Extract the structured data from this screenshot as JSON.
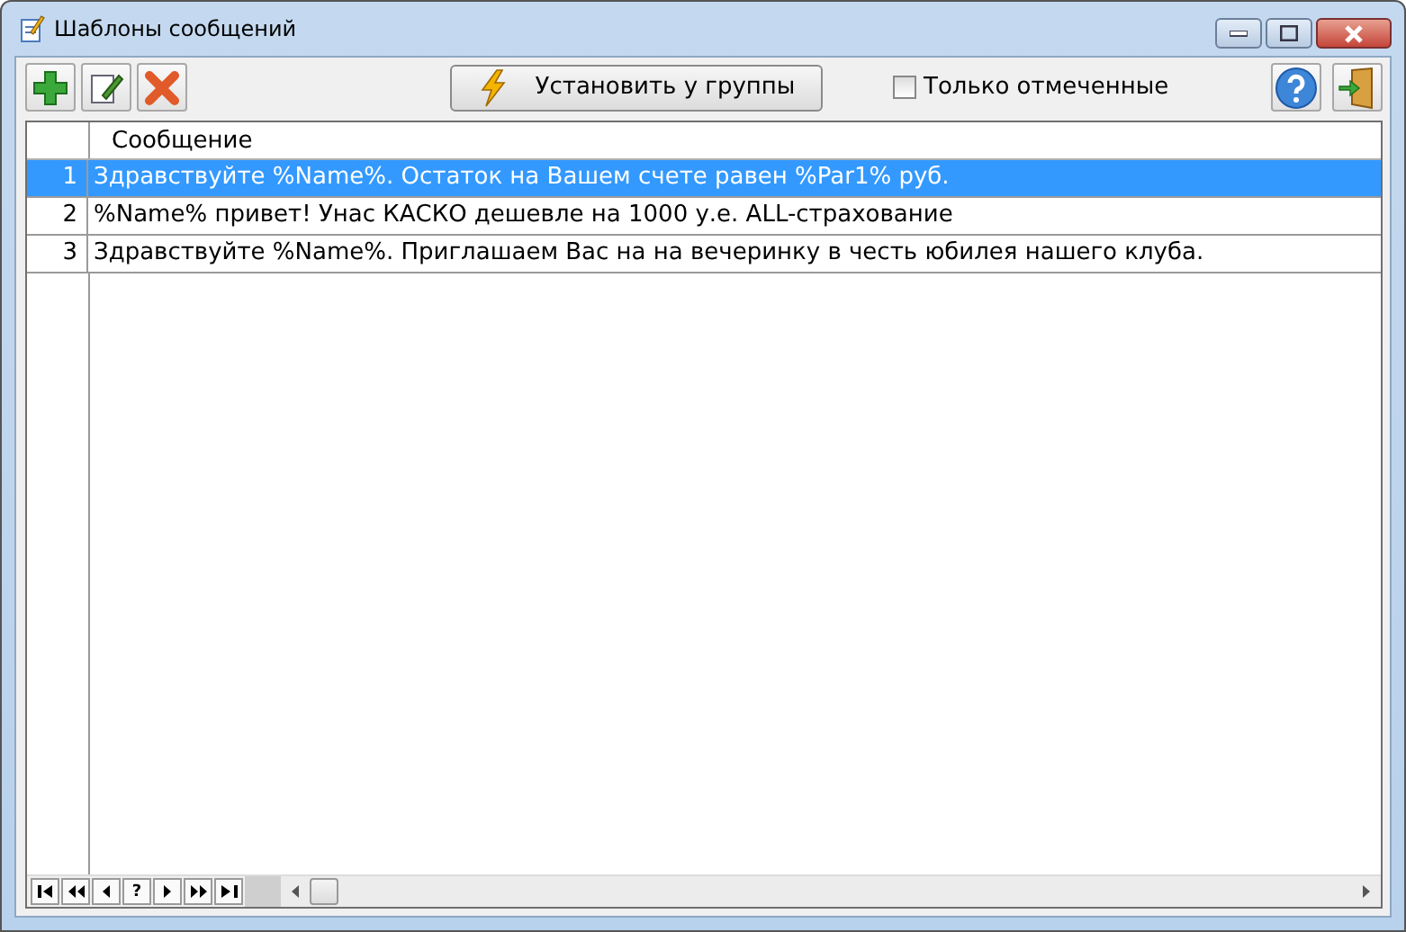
{
  "window": {
    "title": "Шаблоны сообщений"
  },
  "toolbar": {
    "apply_button": "Установить у группы",
    "only_marked": {
      "label": "Только отмеченные",
      "checked": false
    }
  },
  "table": {
    "columns": [
      "Сообщение"
    ],
    "rows": [
      {
        "number": "1",
        "message": "Здравствуйте %Name%.  Остаток на Вашем счете равен %Par1% руб.",
        "selected": true
      },
      {
        "number": "2",
        "message": "%Name% привет! Унас КАСКО дешевле на 1000 у.е. ALL-страхование",
        "selected": false
      },
      {
        "number": "3",
        "message": "Здравствуйте %Name%.  Приглашаем Вас на на вечеринку в честь юбилея нашего клуба.",
        "selected": false
      }
    ]
  },
  "navigator": {
    "help_label": "?"
  }
}
